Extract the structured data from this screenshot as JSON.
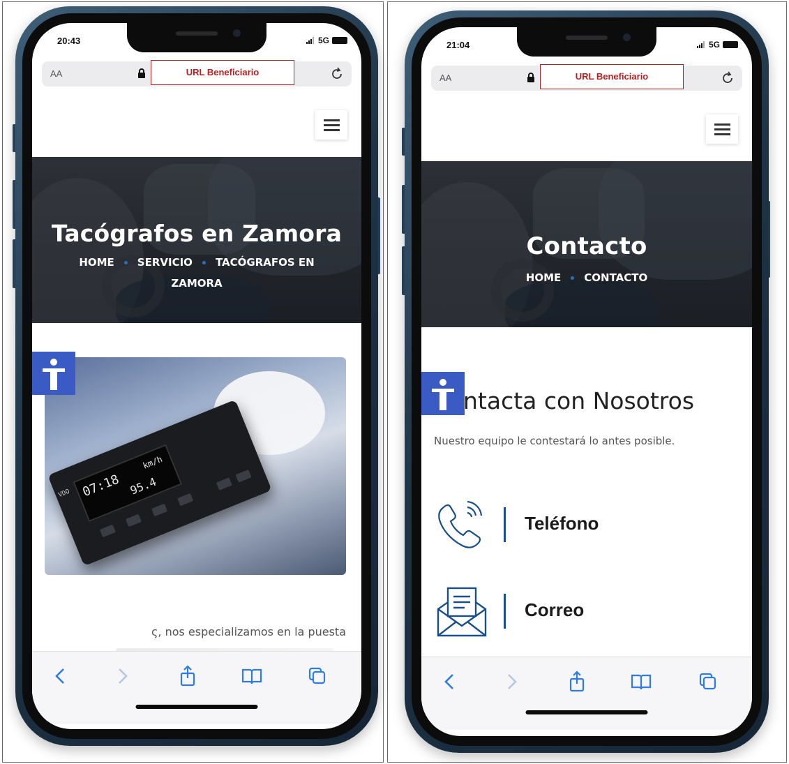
{
  "left_phone": {
    "status": {
      "time": "20:43",
      "network": "5G"
    },
    "browser": {
      "aa_label": "AA",
      "url_label": "URL Beneficiario"
    },
    "hero": {
      "title": "Tacógrafos en Zamora",
      "breadcrumb": [
        "HOME",
        "SERVICIO",
        "TACÓGRAFOS EN"
      ],
      "breadcrumb_wrap": "ZAMORA"
    },
    "tachograph_display": {
      "brand": "VDO",
      "time": "07:18",
      "speed": "95.4",
      "unit": "km/h"
    },
    "body_text": "ς, nos especializamos en la puesta"
  },
  "right_phone": {
    "status": {
      "time": "21:04",
      "network": "5G"
    },
    "browser": {
      "aa_label": "AA",
      "url_label": "URL Beneficiario"
    },
    "hero": {
      "title": "Contacto",
      "breadcrumb": [
        "HOME",
        "CONTACTO"
      ]
    },
    "section_title": "ntacta con Nosotros",
    "section_subtitle": "Nuestro equipo le contestará lo antes posible.",
    "contact_items": [
      {
        "label": "Teléfono",
        "icon": "phone-icon"
      },
      {
        "label": "Correo",
        "icon": "envelope-icon"
      }
    ]
  },
  "colors": {
    "url_highlight": "#b22222",
    "accessibility_button": "#3b5bc4",
    "accent_blue": "#1b4f8a",
    "safari_blue": "#2f7be0"
  },
  "icons": [
    "signal-icon",
    "battery-icon",
    "lock-icon",
    "reload-icon",
    "hamburger-icon",
    "accessibility-icon",
    "back-icon",
    "forward-icon",
    "share-icon",
    "bookmarks-icon",
    "tabs-icon"
  ]
}
